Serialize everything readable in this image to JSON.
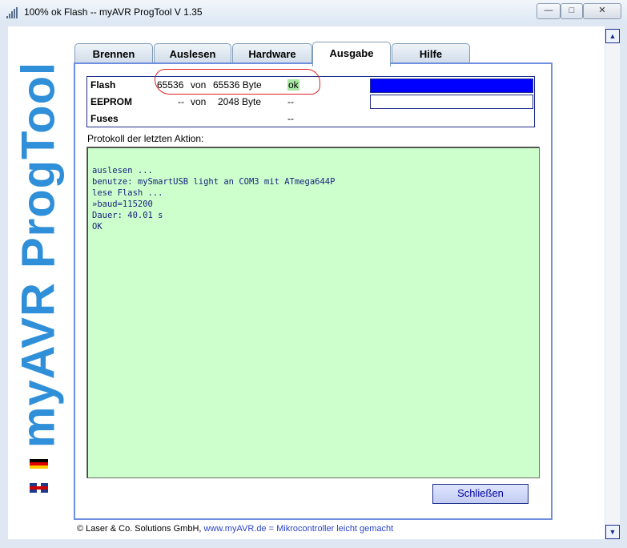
{
  "window": {
    "title": "100% ok Flash -- myAVR ProgTool V 1.35",
    "minimize": "—",
    "maximize": "□",
    "close": "✕"
  },
  "sidebar": {
    "logo": "myAVR ProgTool",
    "flags": [
      "flag-de-icon",
      "flag-uk-icon"
    ]
  },
  "tabs": [
    {
      "label": "Brennen",
      "active": false
    },
    {
      "label": "Auslesen",
      "active": false
    },
    {
      "label": "Hardware",
      "active": false
    },
    {
      "label": "Ausgabe",
      "active": true
    },
    {
      "label": "Hilfe",
      "active": false
    }
  ],
  "status": {
    "flash": {
      "label": "Flash",
      "read": "65536",
      "von": "von",
      "total": "65536 Byte",
      "result": "ok",
      "progress": 1.0
    },
    "eeprom": {
      "label": "EEPROM",
      "read": "--",
      "von": "von",
      "total": "2048 Byte",
      "result": "--",
      "progress": 0.0
    },
    "fuses": {
      "label": "Fuses",
      "result": "--"
    }
  },
  "log": {
    "caption": "Protokoll der letzten Aktion:",
    "text": "auslesen ...\nbenutze: mySmartUSB light an COM3 mit ATmega644P\nlese Flash ...\n»baud=115200\nDauer: 40.01 s\nOK"
  },
  "buttons": {
    "close": "Schließen"
  },
  "footer": {
    "company": "© Laser & Co. Solutions GmbH,",
    "website": "www.myAVR.de",
    "separator": "=",
    "slogan": "Mikrocontroller leicht gemacht"
  },
  "scrollbar": {
    "up": "▲",
    "down": "▼"
  },
  "colors": {
    "accent": "#6e8ee0",
    "logo": "#2f8fd8",
    "progress": "#0000ff",
    "log_bg": "#ccffcc",
    "highlight": "#dd2222"
  }
}
